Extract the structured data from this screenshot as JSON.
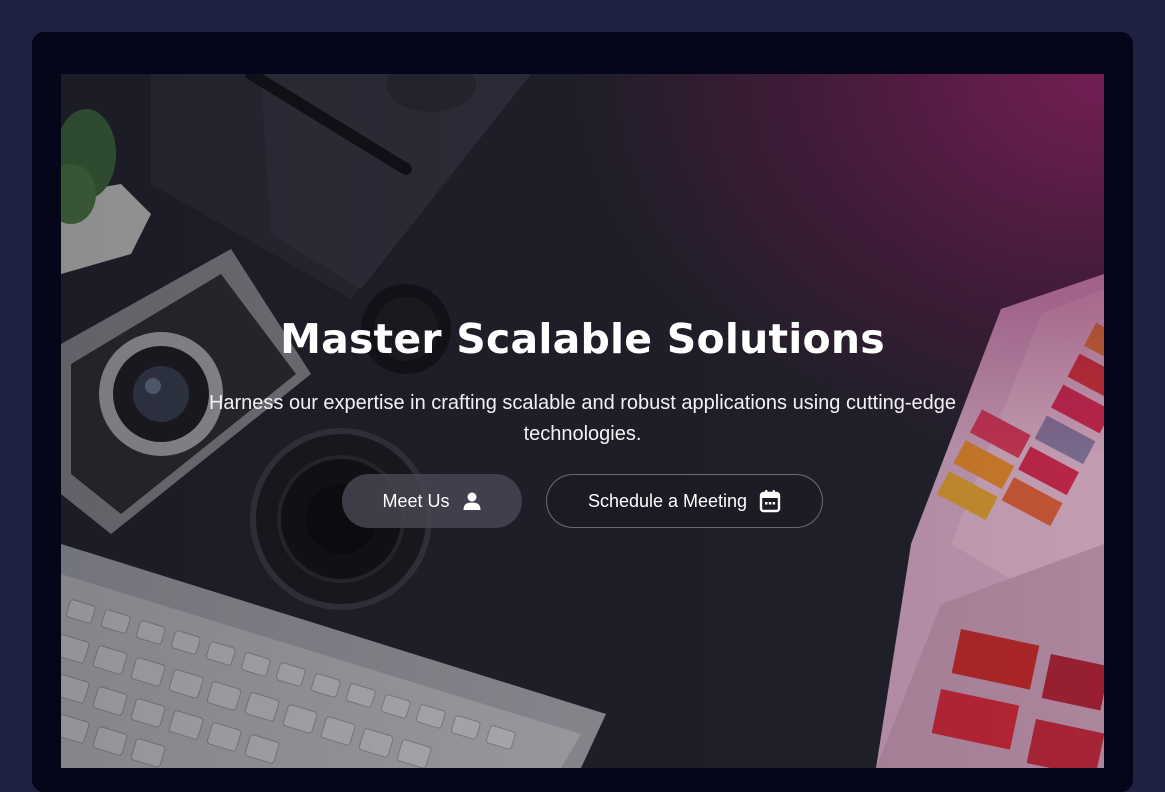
{
  "hero": {
    "title": "Master Scalable Solutions",
    "subtitle": "Harness our expertise in crafting scalable and robust applications using cutting-edge technologies.",
    "primary_button": {
      "label": "Meet Us",
      "icon": "user-icon"
    },
    "secondary_button": {
      "label": "Schedule a Meeting",
      "icon": "calendar-icon"
    }
  },
  "colors": {
    "page_background": "#1f2140",
    "frame_background": "#05061a",
    "overlay_accent": "#8a1a5a",
    "text": "#ffffff"
  }
}
